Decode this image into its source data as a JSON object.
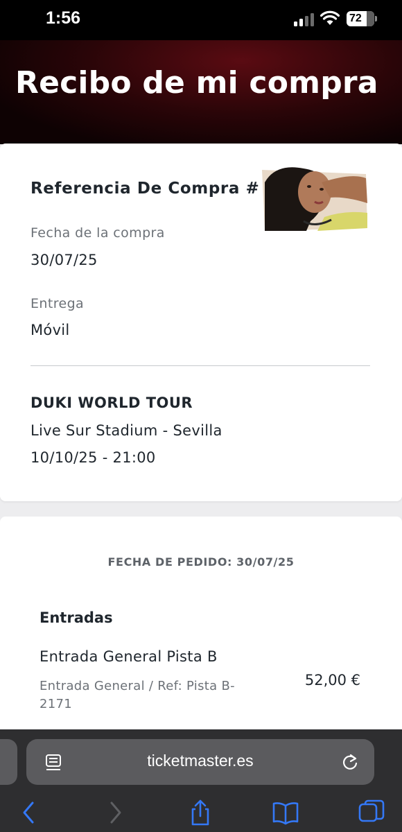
{
  "status_bar": {
    "time": "1:56",
    "battery": "72",
    "battery_level": 0.72
  },
  "header": {
    "title": "Recibo de mi compra"
  },
  "purchase": {
    "reference_title": "Referencia De Compra #9",
    "date_label": "Fecha de la compra",
    "date_value": "30/07/25",
    "delivery_label": "Entrega",
    "delivery_value": "Móvil"
  },
  "event": {
    "name": "DUKI WORLD TOUR",
    "venue": "Live Sur Stadium - Sevilla",
    "datetime": "10/10/25 - 21:00"
  },
  "order": {
    "date_line": "FECHA DE PEDIDO: 30/07/25",
    "section_title": "Entradas",
    "ticket_name": "Entrada General Pista B",
    "ticket_desc": "Entrada General / Ref: Pista B-2171",
    "ticket_price": "52,00 €"
  },
  "browser": {
    "url": "ticketmaster.es",
    "icons": [
      "reader-icon",
      "reload-icon",
      "back-icon",
      "forward-icon",
      "share-icon",
      "bookmarks-icon",
      "tabs-icon"
    ]
  },
  "colors": {
    "header_red": "#5a0b12",
    "text_dark": "#1f262d",
    "text_muted": "#6c7177",
    "toolbar": "#2e2e30",
    "ios_blue": "#3478f6"
  }
}
